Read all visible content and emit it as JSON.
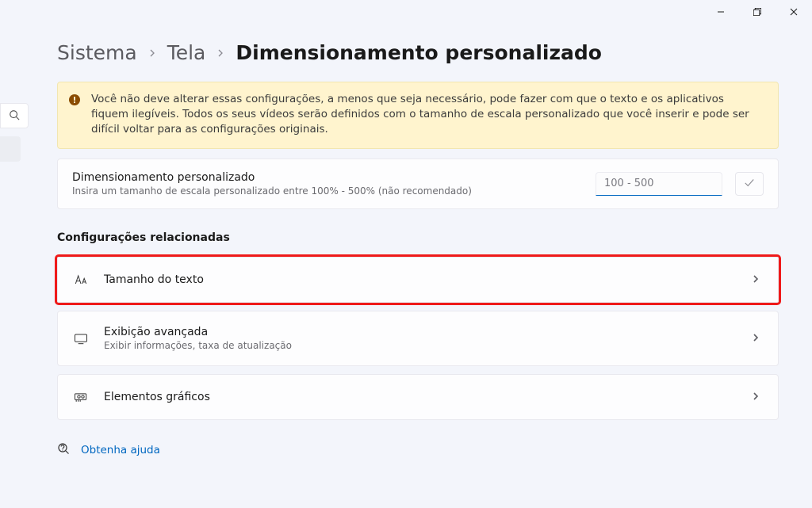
{
  "breadcrumb": {
    "root": "Sistema",
    "mid": "Tela",
    "current": "Dimensionamento personalizado"
  },
  "warning": {
    "text": "Você não deve alterar essas configurações, a menos que seja necessário, pode fazer com que o texto e os aplicativos fiquem ilegíveis. Todos os seus vídeos serão definidos com o tamanho de escala personalizado que você inserir e pode ser difícil voltar para as configurações originais."
  },
  "scale": {
    "title": "Dimensionamento personalizado",
    "subtitle": "Insira um tamanho de escala personalizado entre 100% - 500% (não recomendado)",
    "placeholder": "100 - 500"
  },
  "section_header": "Configurações relacionadas",
  "related": {
    "text_size": {
      "title": "Tamanho do texto"
    },
    "advanced_display": {
      "title": "Exibição avançada",
      "subtitle": "Exibir informações, taxa de atualização"
    },
    "graphics": {
      "title": "Elementos gráficos"
    }
  },
  "help": {
    "label": "Obtenha ajuda"
  }
}
